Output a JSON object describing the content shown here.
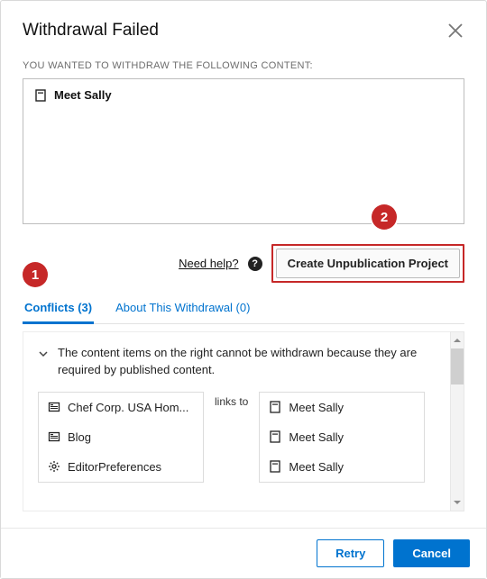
{
  "dialog": {
    "title": "Withdrawal Failed",
    "subhead": "YOU WANTED TO WITHDRAW THE FOLLOWING CONTENT:"
  },
  "content_items": [
    {
      "label": "Meet Sally"
    }
  ],
  "help": {
    "link_label": "Need help?",
    "button_label": "Create Unpublication Project"
  },
  "tabs": {
    "conflicts": {
      "label": "Conflicts (3)"
    },
    "about": {
      "label": "About This Withdrawal (0)"
    }
  },
  "conflict_message": "The content items on the right cannot be withdrawn because they are required by published content.",
  "links_to_label": "links to",
  "left_items": [
    "Chef Corp. USA Hom...",
    "Blog",
    "EditorPreferences"
  ],
  "right_items": [
    "Meet Sally",
    "Meet Sally",
    "Meet Sally"
  ],
  "footer": {
    "retry": "Retry",
    "cancel": "Cancel"
  },
  "annotations": {
    "one": "1",
    "two": "2"
  }
}
